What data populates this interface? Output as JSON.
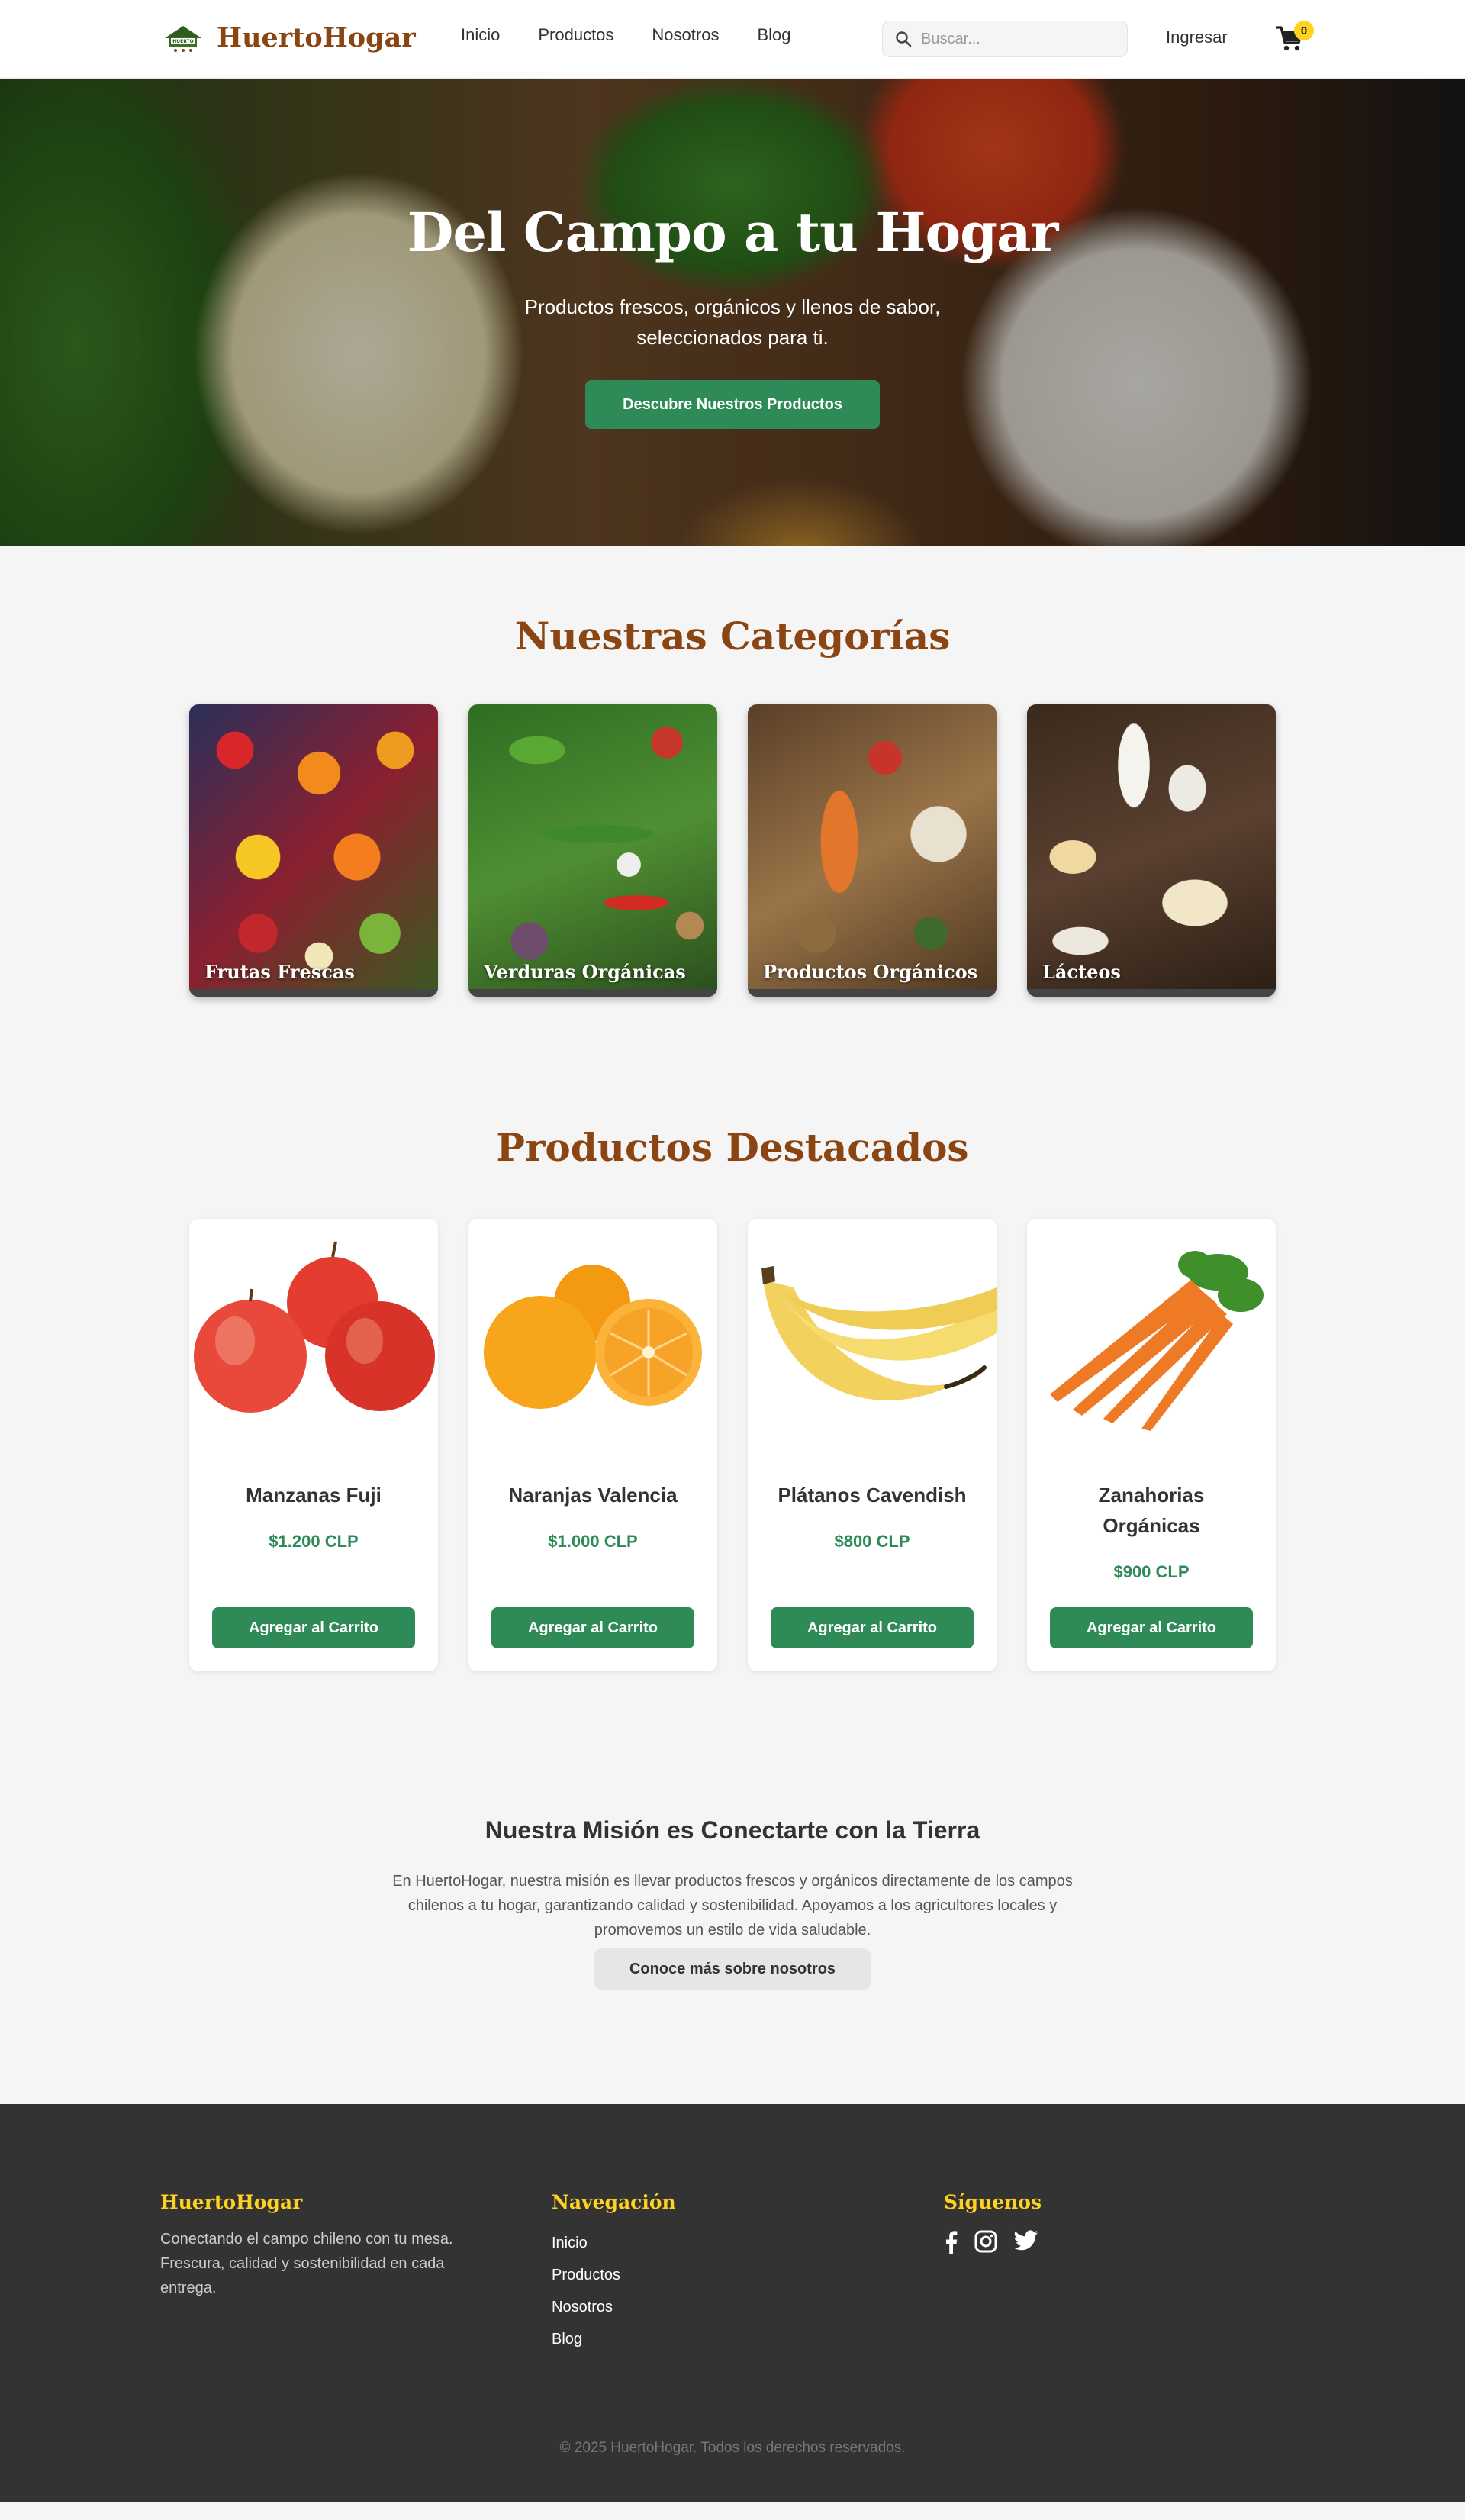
{
  "header": {
    "brand": "HuertoHogar",
    "nav": [
      "Inicio",
      "Productos",
      "Nosotros",
      "Blog"
    ],
    "search_placeholder": "Buscar...",
    "login": "Ingresar",
    "cart_count": "0"
  },
  "hero": {
    "title": "Del Campo a tu Hogar",
    "subtitle": "Productos frescos, orgánicos y llenos de sabor, seleccionados para ti.",
    "button": "Descubre Nuestros Productos"
  },
  "categories": {
    "title": "Nuestras Categorías",
    "items": [
      "Frutas Frescas",
      "Verduras Orgánicas",
      "Productos Orgánicos",
      "Lácteos"
    ]
  },
  "products": {
    "title": "Productos Destacados",
    "items": [
      {
        "name": "Manzanas Fuji",
        "price": "$1.200 CLP",
        "button": "Agregar al Carrito"
      },
      {
        "name": "Naranjas Valencia",
        "price": "$1.000 CLP",
        "button": "Agregar al Carrito"
      },
      {
        "name": "Plátanos Cavendish",
        "price": "$800 CLP",
        "button": "Agregar al Carrito"
      },
      {
        "name": "Zanahorias Orgánicas",
        "price": "$900 CLP",
        "button": "Agregar al Carrito"
      }
    ]
  },
  "mission": {
    "title": "Nuestra Misión es Conectarte con la Tierra",
    "text": "En HuertoHogar, nuestra misión es llevar productos frescos y orgánicos directamente de los campos chilenos a tu hogar, garantizando calidad y sostenibilidad. Apoyamos a los agricultores locales y promovemos un estilo de vida saludable.",
    "button": "Conoce más sobre nosotros"
  },
  "footer": {
    "brand_title": "HuertoHogar",
    "brand_text": "Conectando el campo chileno con tu mesa. Frescura, calidad y sostenibilidad en cada entrega.",
    "nav_title": "Navegación",
    "nav": [
      "Inicio",
      "Productos",
      "Nosotros",
      "Blog"
    ],
    "social_title": "Síguenos",
    "socials": [
      "facebook-icon",
      "instagram-icon",
      "twitter-icon"
    ],
    "copyright": "© 2025 HuertoHogar. Todos los derechos reservados."
  },
  "colors": {
    "brand_brown": "#8b4513",
    "accent_green": "#2e8b57",
    "footer_bg": "#333333",
    "footer_heading": "#ffd21f"
  }
}
